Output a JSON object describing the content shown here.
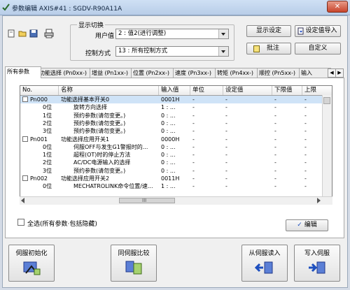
{
  "window": {
    "title": "参数编辑 AXIS#41 : SGDV-R90A11A",
    "close_label": "✕"
  },
  "toolbar": {
    "icons": [
      "new-file-icon",
      "open-folder-icon",
      "save-disk-icon",
      "print-icon"
    ]
  },
  "display_group": {
    "legend": "显示切换",
    "user_level_label": "用户值",
    "user_level_value": "2 : 值2(进行调整)",
    "control_mode_label": "控制方式",
    "control_mode_value": "13 : 所有控制方式"
  },
  "actions": {
    "display_settings": "显示设定",
    "import_settings": "设定值导入",
    "note": "批注",
    "custom": "自定义"
  },
  "tabs": [
    "所有参数",
    "功能选择 (Pn0xx-)",
    "增益 (Pn1xx-)",
    "位置 (Pn2xx-)",
    "速度 (Pn3xx-)",
    "转矩 (Pn4xx-)",
    "顺控 (Pn5xx-)",
    "输入"
  ],
  "table": {
    "columns": [
      "No.",
      "名称",
      "输入值",
      "单位",
      "设定值",
      "下限值",
      "上限"
    ],
    "rows": [
      {
        "no": "Pn000",
        "name": "功能选择基本开关0",
        "input": "0001H",
        "unit": "-",
        "set": "-",
        "low": "-",
        "high": "-",
        "is_group": true,
        "checked": false,
        "selected": true
      },
      {
        "no": "0位",
        "name": "旋转方向选择",
        "input": "1 : ...",
        "unit": "-",
        "set": "-",
        "low": "-",
        "high": "-",
        "is_group": false,
        "checked": false,
        "selected": false
      },
      {
        "no": "1位",
        "name": "预约参数(请勿变更。)",
        "input": "0 : ...",
        "unit": "-",
        "set": "-",
        "low": "-",
        "high": "-",
        "is_group": false,
        "checked": false,
        "selected": false
      },
      {
        "no": "2位",
        "name": "预约参数(请勿变更。)",
        "input": "0 : ...",
        "unit": "-",
        "set": "-",
        "low": "-",
        "high": "-",
        "is_group": false,
        "checked": false,
        "selected": false
      },
      {
        "no": "3位",
        "name": "预约参数(请勿变更。)",
        "input": "0 : ...",
        "unit": "-",
        "set": "-",
        "low": "-",
        "high": "-",
        "is_group": false,
        "checked": false,
        "selected": false
      },
      {
        "no": "Pn001",
        "name": "功能选择应用开关1",
        "input": "0000H",
        "unit": "-",
        "set": "-",
        "low": "-",
        "high": "-",
        "is_group": true,
        "checked": false,
        "selected": false
      },
      {
        "no": "0位",
        "name": "伺服OFF与发生G1警报时的...",
        "input": "0 : ...",
        "unit": "-",
        "set": "-",
        "low": "-",
        "high": "-",
        "is_group": false,
        "checked": false,
        "selected": false
      },
      {
        "no": "1位",
        "name": "超程(OT)时的停止方法",
        "input": "0 : ...",
        "unit": "-",
        "set": "-",
        "low": "-",
        "high": "-",
        "is_group": false,
        "checked": false,
        "selected": false
      },
      {
        "no": "2位",
        "name": "AC/DC电源输入的选择",
        "input": "0 : ...",
        "unit": "-",
        "set": "-",
        "low": "-",
        "high": "-",
        "is_group": false,
        "checked": false,
        "selected": false
      },
      {
        "no": "3位",
        "name": "预约参数(请勿变更。)",
        "input": "0 : ...",
        "unit": "-",
        "set": "-",
        "low": "-",
        "high": "-",
        "is_group": false,
        "checked": false,
        "selected": false
      },
      {
        "no": "Pn002",
        "name": "功能选择应用开关2",
        "input": "0011H",
        "unit": "-",
        "set": "-",
        "low": "-",
        "high": "-",
        "is_group": true,
        "checked": false,
        "selected": false
      },
      {
        "no": "0位",
        "name": "MECHATROLINK命令位置/速...",
        "input": "1 : ...",
        "unit": "-",
        "set": "-",
        "low": "-",
        "high": "-",
        "is_group": false,
        "checked": false,
        "selected": false
      }
    ],
    "scrollbar_glyph": "III"
  },
  "select_all": {
    "label": "全选(所有参数·包括隐藏)",
    "checked": false
  },
  "edit_button": {
    "label": "编辑",
    "check_glyph": "✓"
  },
  "bottom_buttons": {
    "servo_init": "伺服初始化",
    "servo_compare": "同伺服比较",
    "read_from_servo": "从伺服读入",
    "write_to_servo": "写入伺服"
  }
}
